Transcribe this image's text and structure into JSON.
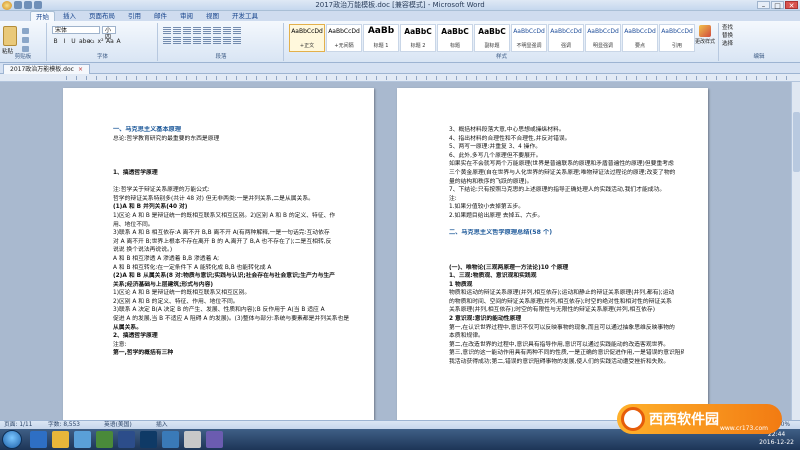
{
  "window": {
    "title": "2017政治万能模板.doc [兼容模式] - Microsoft Word"
  },
  "tabs": [
    "开始",
    "插入",
    "页面布局",
    "引用",
    "邮件",
    "审阅",
    "视图",
    "开发工具"
  ],
  "ribbon": {
    "clipboard": {
      "paste": "粘贴",
      "label": "剪贴板"
    },
    "font": {
      "name": "宋体",
      "size": "小四",
      "label": "字体",
      "buttons": [
        "B",
        "I",
        "U",
        "abe",
        "x₂",
        "x²",
        "Aa",
        "A"
      ]
    },
    "paragraph": {
      "label": "段落"
    },
    "styles": {
      "label": "样式",
      "items": [
        {
          "preview": "AaBbCcDd",
          "name": "+正文"
        },
        {
          "preview": "AaBbCcDd",
          "name": "+无间隔"
        },
        {
          "preview": "AaBb",
          "name": "标题 1"
        },
        {
          "preview": "AaBbC",
          "name": "标题 2"
        },
        {
          "preview": "AaBbC",
          "name": "标题"
        },
        {
          "preview": "AaBbC",
          "name": "副标题"
        },
        {
          "preview": "AaBbCcDd",
          "name": "不明显强调"
        },
        {
          "preview": "AaBbCcDd",
          "name": "强调"
        },
        {
          "preview": "AaBbCcDd",
          "name": "明显强调"
        },
        {
          "preview": "AaBbCcDd",
          "name": "要点"
        },
        {
          "preview": "AaBbCcDd",
          "name": "引用"
        },
        {
          "preview": "AaBbCcDd",
          "name": "明显引用"
        },
        {
          "preview": "AaBbCcDd",
          "name": "不明显参考"
        },
        {
          "preview": "AaBbCcDd",
          "name": "明显参考"
        }
      ],
      "change": "更改样式"
    },
    "editing": {
      "find": "查找",
      "replace": "替换",
      "select": "选择",
      "label": "编辑"
    }
  },
  "doc_tab": "2017政治万能模板.doc",
  "page1": [
    {
      "t": "一、马克思主义基本原理",
      "s": "h"
    },
    {
      "t": "总论:哲学教育研究的最重要的东西是原理",
      "s": ""
    },
    {
      "t": "",
      "s": "gap"
    },
    {
      "t": "",
      "s": "gap"
    },
    {
      "t": "",
      "s": "gap"
    },
    {
      "t": "1、搞透哲学原理",
      "s": "b"
    },
    {
      "t": "",
      "s": "gap"
    },
    {
      "t": "注:哲学关于辩证关系原理的万能公式:",
      "s": ""
    },
    {
      "t": "哲学的辩证关系特别多(共计 48 对) 但无非两类:一是并列关系,二是从属关系。",
      "s": ""
    },
    {
      "t": "(1)A 和 B 并列关系(40 对)",
      "s": "b"
    },
    {
      "t": "1)区论 A 和 B 是辩证统一的既相互联系又相互区别。2)区别 A 和 B 的定义、特征、作",
      "s": ""
    },
    {
      "t": "用、地位不同。",
      "s": ""
    },
    {
      "t": "3)联系 A 和 B 相互依存:A 离不开 B,B 离不开 A(有两种解释,一是一句话完:互动依存",
      "s": ""
    },
    {
      "t": "对 A 离不开 B;世界上根本不存在离开 B 的 A,离开了 B,A 也不存在了);二是互相转,反",
      "s": ""
    },
    {
      "t": "说说 换个说法再说说。)",
      "s": ""
    },
    {
      "t": "A 和 B 相互渗透 A 渗透着 B,B 渗透着 A;",
      "s": ""
    },
    {
      "t": "A 和 B 相互转化:在一定条件下 A 能转化成 B,B 也能转化成 A",
      "s": ""
    },
    {
      "t": "(2)A 和 B 从属关系(8 对:物质与意识;实践与认识;社会存在与社会意识;生产力与生产",
      "s": "b"
    },
    {
      "t": "关系;经济基础与上层建筑;形式与内容)",
      "s": "b"
    },
    {
      "t": "1)区论 A 和 B 是辩证统一的既相互联系又相互区别。",
      "s": ""
    },
    {
      "t": "2)区别 A 和 B 的定义、特征、作用、地位不同。",
      "s": ""
    },
    {
      "t": "3)联系 A 决定 B(A 决定 B 的产生、发展、性质和内容);B 反作用于 A(当 B 适应 A",
      "s": ""
    },
    {
      "t": "促进 A 的发展,当 B 不适应 A 阻碍 A 的发展)。(3)整体与部分:系统与要素都是并列关系也是",
      "s": ""
    },
    {
      "t": "从属关系。",
      "s": "b"
    },
    {
      "t": "2、搞透哲学原理",
      "s": "b"
    },
    {
      "t": "注意:",
      "s": ""
    },
    {
      "t": "第一,哲学的概括有三种",
      "s": "b"
    }
  ],
  "page2": [
    {
      "t": "3、概括材料段落大意,中心思想或操纵材料。",
      "s": ""
    },
    {
      "t": "4、指出材料的合理性和不合理性,并反对错误。",
      "s": ""
    },
    {
      "t": "5、两写一原理:并重复 3、4 操作。",
      "s": ""
    },
    {
      "t": "6、此外,多写几个原理但不要展开。",
      "s": ""
    },
    {
      "t": "如果实在不会就写两个万能原理(世界是普遍联系的原理和矛盾普遍性的原理)但要重考虑",
      "s": ""
    },
    {
      "t": "三个黄金原理(自在世界与人化世界的辩证关系原理;唯物辩证法过程论的原理;改变了物的",
      "s": ""
    },
    {
      "t": "量的结构和秩序的飞跃的原理)。",
      "s": ""
    },
    {
      "t": "7、下结论:只有按照马克思的上述原理的指导正确处理人的实践活动,我们才能成功。",
      "s": ""
    },
    {
      "t": "注:",
      "s": ""
    },
    {
      "t": "1.如果分值较小去掉第五步。",
      "s": ""
    },
    {
      "t": "2.如果题目给出原理 去掉五、六步。",
      "s": ""
    },
    {
      "t": "",
      "s": "gap"
    },
    {
      "t": "二、马克思主义哲学原理总结(58 个)",
      "s": "h"
    },
    {
      "t": "",
      "s": "gap"
    },
    {
      "t": "",
      "s": "gap"
    },
    {
      "t": "",
      "s": "gap"
    },
    {
      "t": "(一)、唯物论(三观两原理一方法论)10 个原理",
      "s": "b"
    },
    {
      "t": "1、三观:物质观、意识观和实践观",
      "s": "b"
    },
    {
      "t": "1 物质观",
      "s": "b"
    },
    {
      "t": "物质和运动的辩证关系原理(并列,相互依存);运动和静止的辩证关系原理(并列,都有);运动",
      "s": ""
    },
    {
      "t": "的物质和时间、空间的辩证关系原理(并列,相互依存);时空的绝对性和相对性的辩证关系",
      "s": ""
    },
    {
      "t": "关系原理(并列,相互依存);时空的有限性与无限性的辩证关系原理(并列,相互依存)",
      "s": ""
    },
    {
      "t": "2 意识观:意识的能动性原理",
      "s": "b"
    },
    {
      "t": "第一,在认识世界过程中,意识不仅可以反映事物的现象,而且可以通过抽象思维反映事物的",
      "s": ""
    },
    {
      "t": "本质和规律。",
      "s": ""
    },
    {
      "t": "第二,在改造世界的过程中,意识具有指导作用,意识可以通过实践能动的改造客观世界。",
      "s": ""
    },
    {
      "t": "第三,意识的这一能动作用具有两种不同的性质,一是正确的意识促进作用,一是错误的意识阻碍",
      "s": ""
    },
    {
      "t": "我活动获得成功;第二,错误的意识阻碍事物的发展,使人们的实践活动遭受挫折和失败。",
      "s": ""
    }
  ],
  "status": {
    "page": "页面: 1/11",
    "words": "字数: 8,553",
    "lang": "英语(美国)",
    "mode": "插入",
    "zoom": "70%"
  },
  "clock": {
    "time": "22:44",
    "date": "2016-12-22"
  },
  "watermark": {
    "text": "西西软件园",
    "url": "www.cr173.com"
  }
}
